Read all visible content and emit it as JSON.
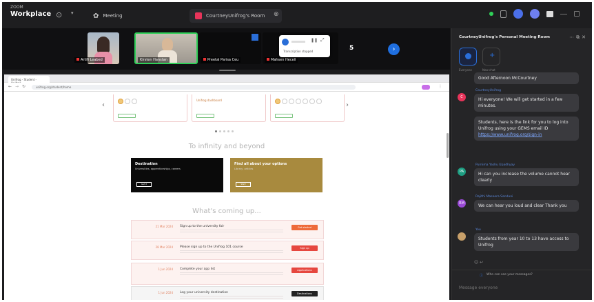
{
  "app": {
    "brand_top": "ZOOM",
    "brand_name": "Workplace"
  },
  "topbar": {
    "meeting_tab_label": "Meeting",
    "active_tab_label": "CourtneyUnifrog's Room"
  },
  "gallery": {
    "participants": [
      {
        "name": "Artifi Leabed"
      },
      {
        "name": "Kirsten Hanstan"
      },
      {
        "name": "Preetal Parisa Ceu"
      },
      {
        "name": "Mahsen Hecell"
      }
    ],
    "more_count": "5",
    "popup_text": "Transcription stopped"
  },
  "browser": {
    "tab_title": "Unifrog - Student - Unifrog",
    "url": "unifrog.org/student/home"
  },
  "page": {
    "card_middle_text": "Unifrog dashboard",
    "heading_infinity": "To infinity and beyond",
    "promo_left_title": "Destination",
    "promo_left_lines": "Universities, apprenticeships, careers",
    "promo_left_btn": "Get it",
    "promo_right_title": "Find all about your options",
    "promo_right_lines": "Library, articles",
    "promo_right_btn": "Start",
    "heading_coming": "What's coming up...",
    "tasks": [
      {
        "date": "21 Mar 2024",
        "title": "Sign up to the university fair",
        "button": "Get started",
        "style": "orange"
      },
      {
        "date": "28 Mar 2024",
        "title": "Please sign up to the Unifrog 101 course",
        "button": "Sign up",
        "style": "red"
      },
      {
        "date": "1 Jun 2024",
        "title": "Complete your app list",
        "button": "Applications",
        "style": "red"
      },
      {
        "date": "1 Jun 2024",
        "title": "Log your university destination",
        "button": "Destinations",
        "style": "dark"
      }
    ]
  },
  "chat": {
    "title": "CourtneyUnifrog's Personal Meeting Room",
    "tab_everyone": "Everyone",
    "tab_direct": "New chat",
    "messages": [
      {
        "author": "",
        "initials": "",
        "color": "#555555",
        "text": "Good Afternoon McCourtney"
      },
      {
        "author": "CourtneyUnifrog",
        "initials": "C",
        "color": "#e8345a",
        "text": "Hi everyone! We will get started in a few minutes."
      },
      {
        "author": "",
        "initials": "",
        "color": "",
        "text": "Students, here is the link for you to log into Unifrog using your GEMS email ID",
        "link": "https://www.unifrog.org/sign-in"
      },
      {
        "author": "Purnima Yashu Upadhyay",
        "initials": "PA",
        "color": "#1e9e82",
        "text": "Hi can you increase the volume cannot hear clearly"
      },
      {
        "author": "Rajithi Maseera Sanduni",
        "initials": "RM",
        "color": "#9a4ad6",
        "text": "We can hear you loud and clear Thank you"
      },
      {
        "author": "You",
        "initials": "",
        "color": "#c8a06a",
        "text": "Students from year 10 to 13 have access to Unifrog"
      }
    ],
    "notice": "Who can see your messages?",
    "input_placeholder": "Message everyone"
  }
}
